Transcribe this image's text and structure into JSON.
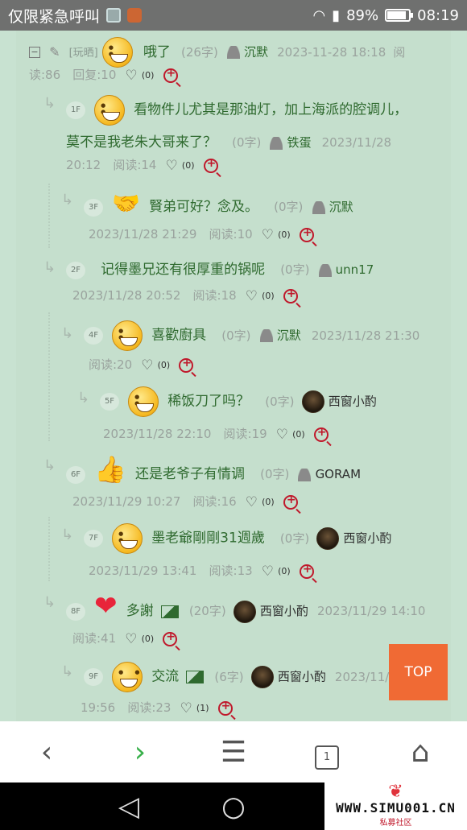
{
  "status_bar": {
    "carrier": "仅限紧急呼叫",
    "battery": "89%",
    "battery_level": 0.89,
    "time": "08:19"
  },
  "thread": {
    "root": {
      "tag": "[玩晒]",
      "title": "哦了",
      "chars": "(26字)",
      "author": "沉默",
      "date": "2023-11-28 18:18",
      "reads_prefix": "阅",
      "reads": "读:86",
      "replies": "回复:10",
      "likes": "(0)"
    },
    "replies": [
      {
        "floor": "1F",
        "title": "看物件儿尤其是那油灯，加上海派的腔调儿，莫不是我老朱大哥来了？",
        "title_line1": "看物件儿尤其是那油灯，加上海派的腔调儿，",
        "title_line2": "莫不是我老朱大哥来了？",
        "chars": "(0字)",
        "author": "铁蛋",
        "date": "2023/11/28",
        "time": "20:12",
        "reads": "阅读:14",
        "likes": "(0)"
      },
      {
        "floor": "3F",
        "title": "賢弟可好？念及。",
        "chars": "(0字)",
        "author": "沉默",
        "date": "2023/11/28 21:29",
        "reads": "阅读:10",
        "likes": "(0)"
      },
      {
        "floor": "2F",
        "title": "记得墨兄还有很厚重的锅呢",
        "chars": "(0字)",
        "author": "unn17",
        "date": "2023/11/28 20:52",
        "reads": "阅读:18",
        "likes": "(0)"
      },
      {
        "floor": "4F",
        "title": "喜歡廚具",
        "chars": "(0字)",
        "author": "沉默",
        "date": "2023/11/28 21:30",
        "reads": "阅读:20",
        "likes": "(0)"
      },
      {
        "floor": "5F",
        "title": "稀饭刀了吗？",
        "chars": "(0字)",
        "author": "西窗小酌",
        "date": "2023/11/28 22:10",
        "reads": "阅读:19",
        "likes": "(0)"
      },
      {
        "floor": "6F",
        "title": "还是老爷子有情调",
        "chars": "(0字)",
        "author": "GORAM",
        "date": "2023/11/29 10:27",
        "reads": "阅读:16",
        "likes": "(0)"
      },
      {
        "floor": "7F",
        "title": "墨老爺剛剛31週歲",
        "chars": "(0字)",
        "author": "西窗小酌",
        "date": "2023/11/29 13:41",
        "reads": "阅读:13",
        "likes": "(0)"
      },
      {
        "floor": "8F",
        "title": "多謝",
        "chars": "(20字)",
        "author": "西窗小酌",
        "date": "2023/11/29 14:10",
        "reads": "阅读:41",
        "likes": "(0)"
      },
      {
        "floor": "9F",
        "title": "交流",
        "chars": "(6字)",
        "author": "西窗小酌",
        "date": "2023/11/",
        "time": "19:56",
        "reads": "阅读:23",
        "likes": "(1)"
      }
    ]
  },
  "top_button": "TOP",
  "browser_nav": {
    "tabs_count": "1"
  },
  "watermark": {
    "site": "WWW.SIMU001.CN",
    "sub": "私募社区"
  },
  "colors": {
    "background": "#c8e2d1",
    "title_green": "#2f6a2f",
    "top_button": "#f06a34",
    "zoom_red": "#c0182b"
  }
}
